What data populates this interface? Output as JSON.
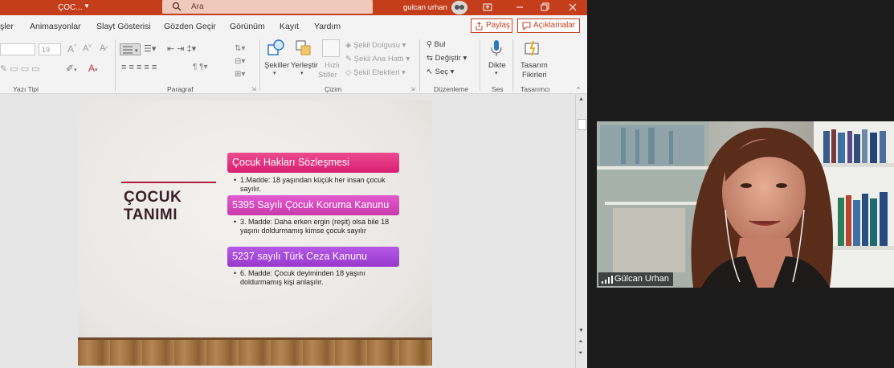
{
  "titlebar": {
    "doc_title": "ÇOC...",
    "search_placeholder": "Ara",
    "user_name": "gulcan urhan"
  },
  "tabs": [
    "şler",
    "Animasyonlar",
    "Slayt Gösterisi",
    "Gözden Geçir",
    "Görünüm",
    "Kayıt",
    "Yardım"
  ],
  "share_label": "Paylaş",
  "comments_label": "Açıklamalar",
  "ribbon": {
    "font_size_value": "19",
    "groups": {
      "font": "Yazı Tipi",
      "paragraph": "Paragraf",
      "drawing": "Çizim",
      "editing": "Düzenleme",
      "voice": "Ses",
      "designer": "Tasarımcı"
    },
    "shapes": "Şekiller",
    "arrange": "Yerleştir",
    "quick_styles_1": "Hızlı",
    "quick_styles_2": "Stiller",
    "shape_fill": "Şekil Dolgusu",
    "shape_outline": "Şekil Ana Hattı",
    "shape_effects": "Şekil Efektleri",
    "find": "Bul",
    "replace": "Değiştir",
    "select": "Seç",
    "dictate": "Dikte",
    "designer_1": "Tasarım",
    "designer_2": "Fikirleri"
  },
  "slide": {
    "title_line1": "ÇOCUK",
    "title_line2": "TANIMI",
    "sections": [
      {
        "header": "Çocuk Hakları Sözleşmesi",
        "bullet": "1.Madde: 18 yaşından küçük her insan çocuk sayılır."
      },
      {
        "header": "5395 Sayılı Çocuk Koruma Kanunu",
        "bullet": "3. Madde:  Daha erken  ergin (reşit) olsa bile 18 yaşını doldurmamış kimse çocuk sayılır"
      },
      {
        "header": "5237 sayılı Türk Ceza Kanunu",
        "bullet": "6. Madde:  Çocuk deyiminden 18 yaşını doldurmamış kişi anlaşılır."
      }
    ],
    "colors": {
      "header1": "#e1287a",
      "header2": "#d23cb5",
      "header3": "#a43cd6",
      "accent_line": "#b01e3c"
    }
  },
  "participant": {
    "name": "Gülcan Urhan"
  },
  "icons": [
    "search-icon",
    "avatar",
    "minimize-icon",
    "restore-icon",
    "close-icon",
    "ribbon-display-icon",
    "share-icon",
    "comments-icon",
    "microphone-icon",
    "designer-icon",
    "signal-icon"
  ]
}
